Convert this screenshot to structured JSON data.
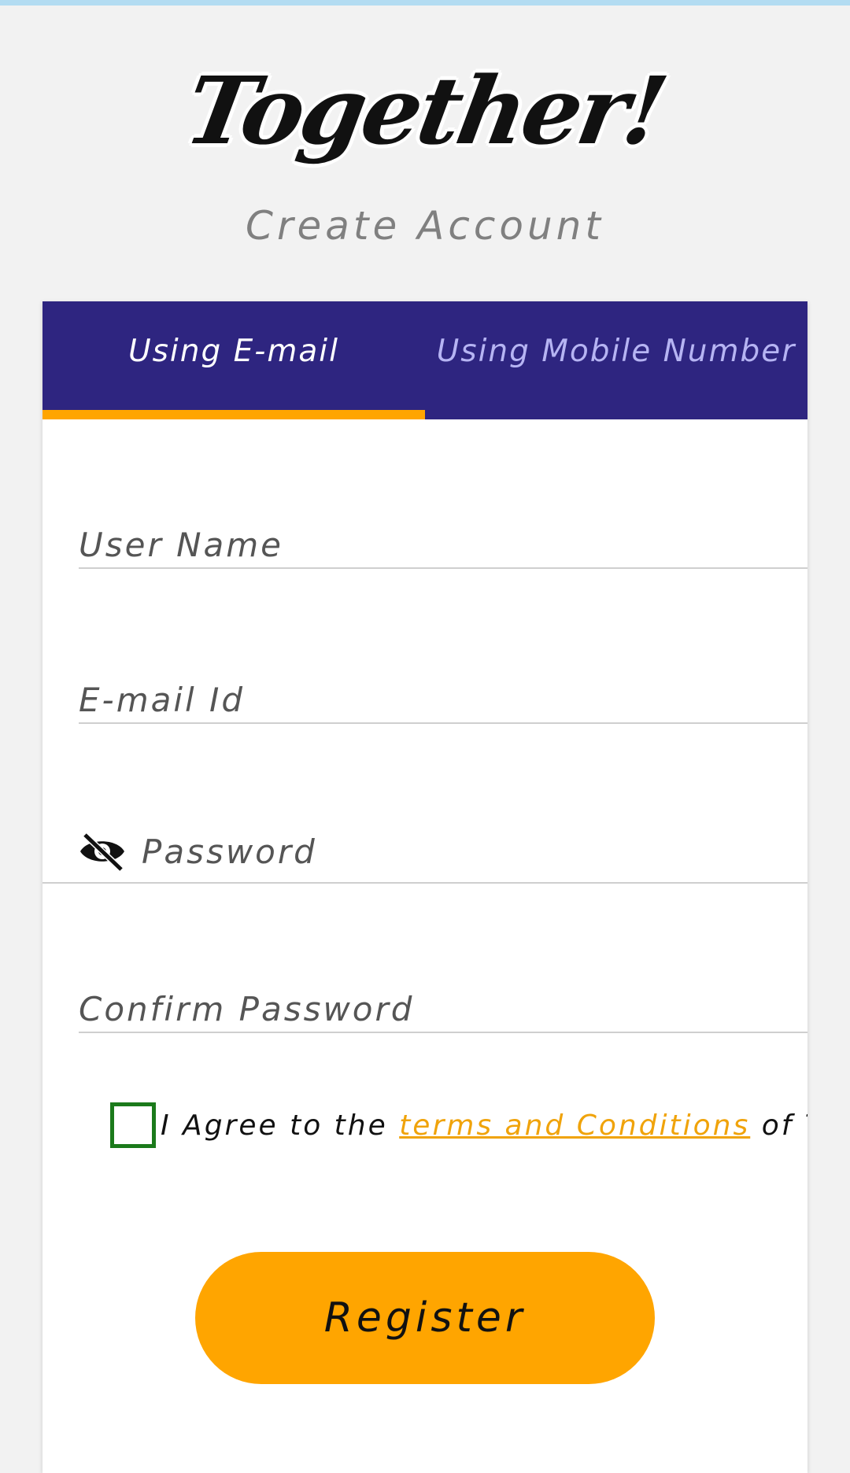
{
  "app": {
    "logo_text": "Together!",
    "subtitle": "Create Account"
  },
  "tabs": [
    {
      "label": "Using E-mail",
      "active": true
    },
    {
      "label": "Using Mobile Number",
      "active": false
    }
  ],
  "form": {
    "username_label": "User Name",
    "email_label": "E-mail Id",
    "password_label": "Password",
    "confirm_password_label": "Confirm Password",
    "agree_prefix": "I Agree to the ",
    "terms_link": "terms and Conditions",
    "agree_suffix": " of Together!",
    "checkbox_checked": false,
    "register_label": "Register"
  },
  "colors": {
    "tab_bar": "#2e2580",
    "accent": "#ffa500",
    "checkbox_border": "#1b7a1b",
    "inactive_tab_text": "#b6b4f3"
  },
  "icons": {
    "password_toggle": "eye-off-icon"
  }
}
